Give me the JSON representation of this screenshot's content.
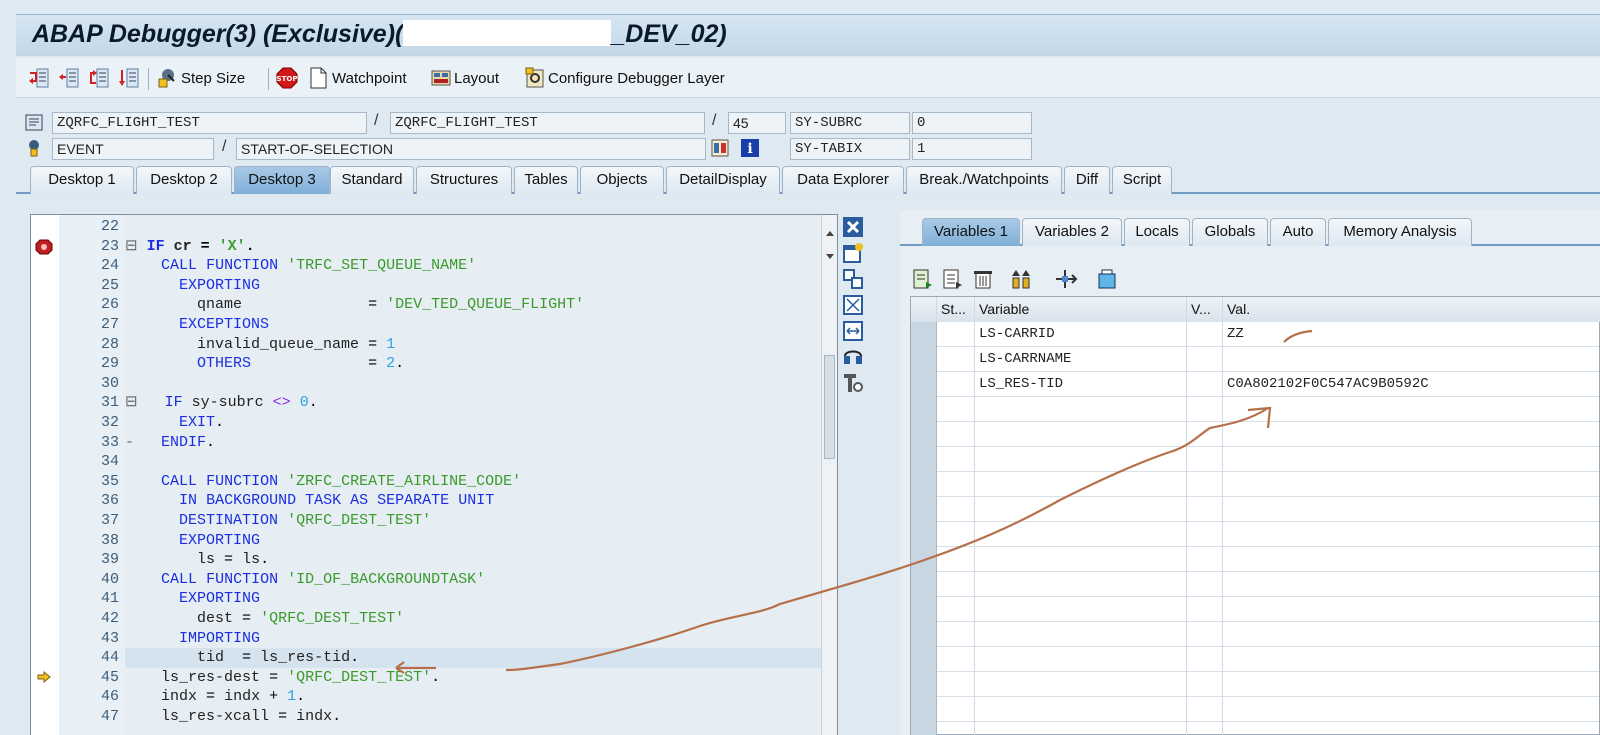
{
  "title": {
    "prefix": "ABAP Debugger(3)  (Exclusive)(",
    "suffix": "_DEV_02)"
  },
  "toolbar": {
    "step_size": "Step Size",
    "watchpoint": "Watchpoint",
    "layout": "Layout",
    "configure_layer": "Configure Debugger Layer"
  },
  "info": {
    "program": "ZQRFC_FLIGHT_TEST",
    "include": "ZQRFC_FLIGHT_TEST",
    "line": "45",
    "subrc_label": "SY-SUBRC",
    "subrc_value": "0",
    "event_type": "EVENT",
    "event_name": "START-OF-SELECTION",
    "tabix_label": "SY-TABIX",
    "tabix_value": "1"
  },
  "tabs": [
    "Desktop 1",
    "Desktop 2",
    "Desktop 3",
    "Standard",
    "Structures",
    "Tables",
    "Objects",
    "DetailDisplay",
    "Data Explorer",
    "Break./Watchpoints",
    "Diff",
    "Script"
  ],
  "active_tab": "Desktop 3",
  "code_lines": [
    {
      "n": "22",
      "t": ""
    },
    {
      "n": "23",
      "t": "IF cr = 'X'."
    },
    {
      "n": "24",
      "t": "  CALL FUNCTION 'TRFC_SET_QUEUE_NAME'"
    },
    {
      "n": "25",
      "t": "    EXPORTING"
    },
    {
      "n": "26",
      "t": "      qname              = 'DEV_TED_QUEUE_FLIGHT'"
    },
    {
      "n": "27",
      "t": "    EXCEPTIONS"
    },
    {
      "n": "28",
      "t": "      invalid_queue_name = 1"
    },
    {
      "n": "29",
      "t": "      OTHERS             = 2."
    },
    {
      "n": "30",
      "t": ""
    },
    {
      "n": "31",
      "t": "  IF sy-subrc <> 0."
    },
    {
      "n": "32",
      "t": "    EXIT."
    },
    {
      "n": "33",
      "t": "  ENDIF."
    },
    {
      "n": "34",
      "t": ""
    },
    {
      "n": "35",
      "t": "  CALL FUNCTION 'ZRFC_CREATE_AIRLINE_CODE'"
    },
    {
      "n": "36",
      "t": "    IN BACKGROUND TASK AS SEPARATE UNIT"
    },
    {
      "n": "37",
      "t": "    DESTINATION 'QRFC_DEST_TEST'"
    },
    {
      "n": "38",
      "t": "    EXPORTING"
    },
    {
      "n": "39",
      "t": "      ls = ls."
    },
    {
      "n": "40",
      "t": "  CALL FUNCTION 'ID_OF_BACKGROUNDTASK'"
    },
    {
      "n": "41",
      "t": "    EXPORTING"
    },
    {
      "n": "42",
      "t": "      dest = 'QRFC_DEST_TEST'"
    },
    {
      "n": "43",
      "t": "    IMPORTING"
    },
    {
      "n": "44",
      "t": "      tid  = ls_res-tid."
    },
    {
      "n": "45",
      "t": "  ls_res-dest = 'QRFC_DEST_TEST'."
    },
    {
      "n": "46",
      "t": "  indx = indx + 1."
    },
    {
      "n": "47",
      "t": "  ls_res-xcall = indx."
    }
  ],
  "right_tabs": [
    "Variables 1",
    "Variables 2",
    "Locals",
    "Globals",
    "Auto",
    "Memory Analysis"
  ],
  "active_right_tab": "Variables 1",
  "grid": {
    "headers": [
      "St...",
      "Variable",
      "V...",
      "Val."
    ],
    "rows": [
      {
        "variable": "LS-CARRID",
        "value": "ZZ"
      },
      {
        "variable": "LS-CARRNAME",
        "value": ""
      },
      {
        "variable": "LS_RES-TID",
        "value": "C0A802102F0C547AC9B0592C"
      }
    ]
  },
  "colors": {
    "keyword": "#1a2ee0",
    "string": "#3b9a2b",
    "number": "#2aa3e0",
    "annotation": "#b5704a"
  }
}
